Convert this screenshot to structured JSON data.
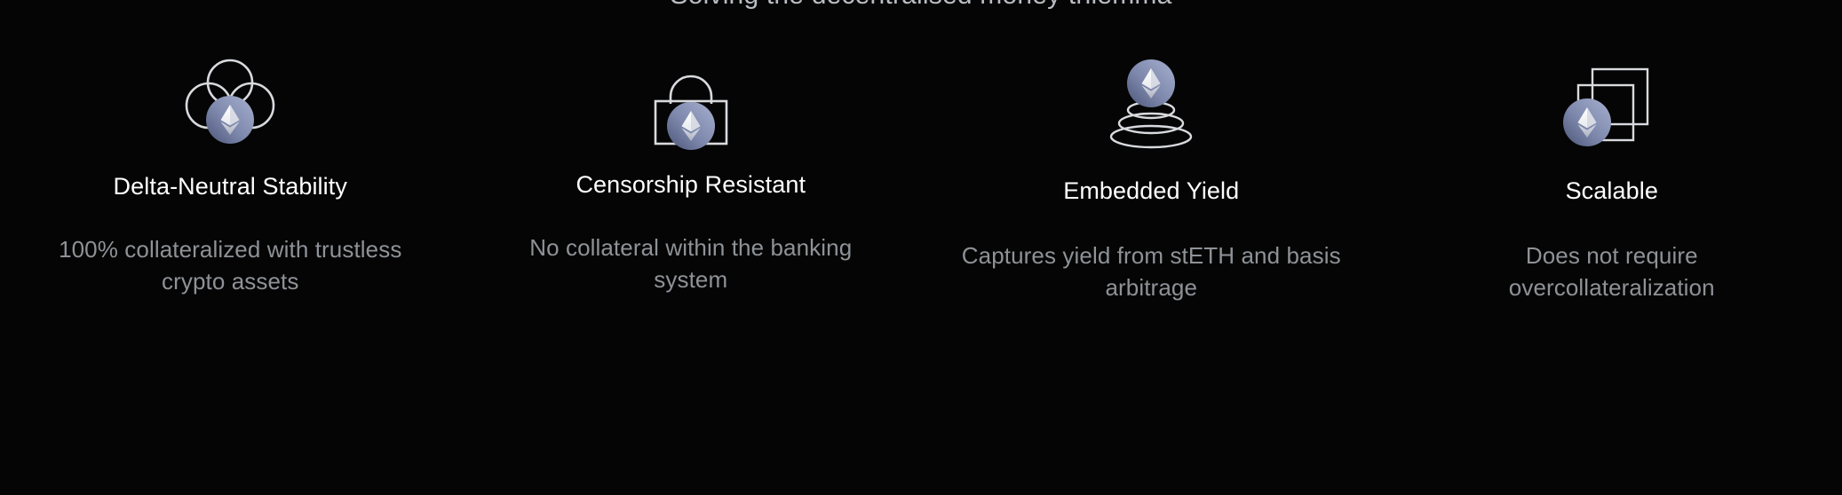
{
  "section": {
    "heading": "Solving the decentralised money trilemma"
  },
  "theme": {
    "background": "#050505",
    "title_color": "#ffffff",
    "body_color": "#8e9297",
    "heading_color": "#b9bcc0",
    "icon_stroke": "#d8dade",
    "badge_gradient_from": "#9aa3c4",
    "badge_gradient_to": "#4e5878",
    "eth_diamond_light": "#ffffff",
    "eth_diamond_dark": "#b6bbc9"
  },
  "features": [
    {
      "icon": "cloud-eth-icon",
      "title": "Delta-Neutral Stability",
      "description_lines": [
        "100% collateralized with trustless",
        "crypto assets"
      ],
      "description": "100% collateralized with trustless crypto assets"
    },
    {
      "icon": "lock-eth-icon",
      "title": "Censorship Resistant",
      "description_lines": [
        "No collateral within the",
        "banking system"
      ],
      "description": "No collateral within the banking system"
    },
    {
      "icon": "stacked-rings-eth-icon",
      "title": "Embedded Yield",
      "description_lines": [
        "Captures yield from stETH",
        "and basis arbitrage"
      ],
      "description": "Captures yield from stETH and basis arbitrage"
    },
    {
      "icon": "nested-squares-eth-icon",
      "title": "Scalable",
      "description_lines": [
        "Does not require",
        "overcollateralization"
      ],
      "description": "Does not require overcollateralization"
    }
  ]
}
